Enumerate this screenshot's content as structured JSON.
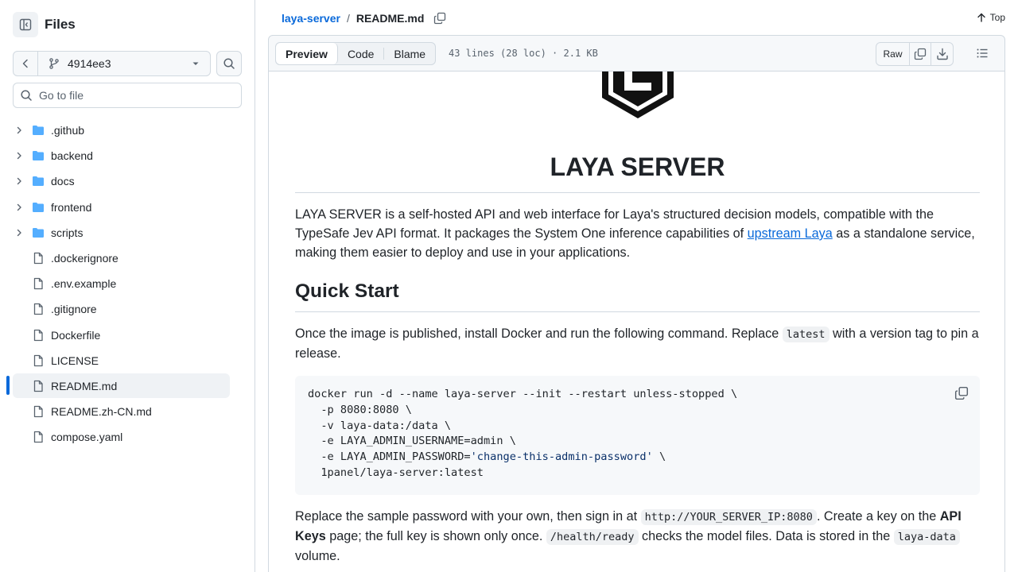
{
  "sidebar": {
    "title": "Files",
    "branch": "4914ee3",
    "goto_placeholder": "Go to file",
    "items": [
      {
        "label": ".github",
        "type": "dir"
      },
      {
        "label": "backend",
        "type": "dir"
      },
      {
        "label": "docs",
        "type": "dir"
      },
      {
        "label": "frontend",
        "type": "dir"
      },
      {
        "label": "scripts",
        "type": "dir"
      },
      {
        "label": ".dockerignore",
        "type": "file"
      },
      {
        "label": ".env.example",
        "type": "file"
      },
      {
        "label": ".gitignore",
        "type": "file"
      },
      {
        "label": "Dockerfile",
        "type": "file"
      },
      {
        "label": "LICENSE",
        "type": "file"
      },
      {
        "label": "README.md",
        "type": "file",
        "active": true
      },
      {
        "label": "README.zh-CN.md",
        "type": "file"
      },
      {
        "label": "compose.yaml",
        "type": "file"
      }
    ]
  },
  "header": {
    "repo": "laya-server",
    "separator": "/",
    "file": "README.md",
    "top_label": "Top"
  },
  "toolbar": {
    "tabs": [
      "Preview",
      "Code",
      "Blame"
    ],
    "active_tab": "Preview",
    "meta": "43 lines (28 loc) · 2.1 KB",
    "raw_label": "Raw"
  },
  "readme": {
    "title": "LAYA SERVER",
    "intro_before_link": "LAYA SERVER is a self-hosted API and web interface for Laya's structured decision models, compatible with the TypeSafe Jev API format. It packages the System One inference capabilities of ",
    "intro_link": "upstream Laya",
    "intro_after_link": " as a standalone service, making them easier to deploy and use in your applications.",
    "h2": "Quick Start",
    "qs_before": "Once the image is published, install Docker and run the following command. Replace ",
    "qs_code": "latest",
    "qs_after": " with a version tag to pin a release.",
    "code_lines": [
      "docker run -d --name laya-server --init --restart unless-stopped \\",
      "  -p 8080:8080 \\",
      "  -v laya-data:/data \\",
      "  -e LAYA_ADMIN_USERNAME=admin \\"
    ],
    "code_line5_before": "  -e LAYA_ADMIN_PASSWORD=",
    "code_line5_string": "'change-this-admin-password'",
    "code_line5_after": " \\",
    "code_line6": "  1panel/laya-server:latest",
    "after_1": "Replace the sample password with your own, then sign in at ",
    "after_code1": "http://YOUR_SERVER_IP:8080",
    "after_2": ". Create a key on the ",
    "after_bold": "API Keys",
    "after_3": " page; the full key is shown only once. ",
    "after_code2": "/health/ready",
    "after_4": " checks the model files. Data is stored in the ",
    "after_code3": "laya-data",
    "after_5": " volume."
  },
  "colors": {
    "link": "#0969da",
    "folder": "#54aeff",
    "border": "#d1d9e0",
    "muted": "#59636e"
  }
}
